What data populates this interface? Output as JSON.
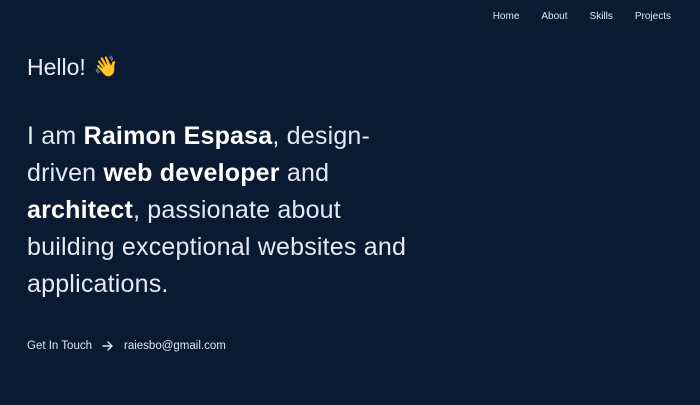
{
  "nav": {
    "items": [
      {
        "label": "Home"
      },
      {
        "label": "About"
      },
      {
        "label": "Skills"
      },
      {
        "label": "Projects"
      }
    ]
  },
  "hero": {
    "greeting": "Hello!",
    "wave_emoji": "👋",
    "intro": {
      "p1": "I am ",
      "name": "Raimon Espasa",
      "p2": ", design-driven ",
      "role1": "web developer",
      "p3": " and ",
      "role2": "architect",
      "p4": ", passionate about building exceptional websites and applications."
    }
  },
  "contact": {
    "label": "Get In Touch",
    "arrow_icon": "arrow-right-icon",
    "email": "raiesbo@gmail.com"
  },
  "colors": {
    "background": "#0b1a33",
    "text": "#e6edf6",
    "accent": "#ffffff"
  }
}
